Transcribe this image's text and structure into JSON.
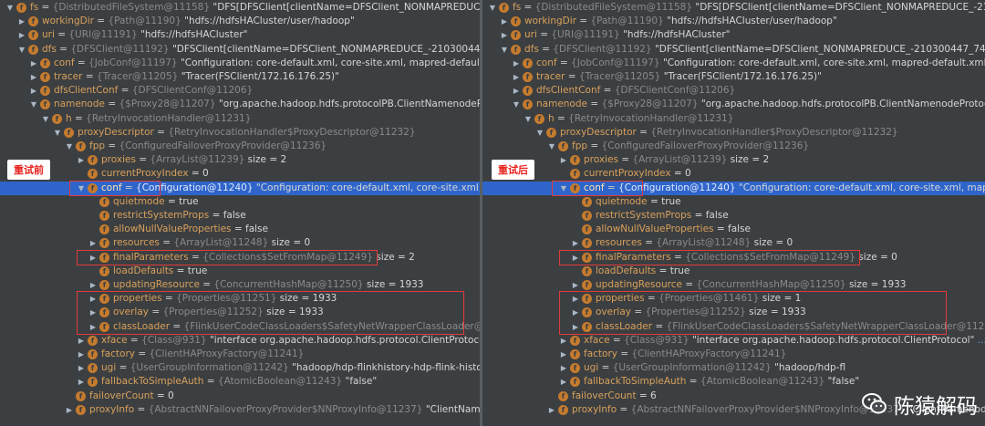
{
  "panels": {
    "left": {
      "badge": "重试前",
      "rows": [
        {
          "d": 0,
          "e": "d",
          "n": "fs",
          "r": "{DistributedFileSystem@11158}",
          "v": "\"DFS[DFSClient[clientName=DFSClient_NONMAPREDUCE_-210300447_74, ugi=hadoop/hdp-"
        },
        {
          "d": 1,
          "e": "r",
          "n": "workingDir",
          "r": "{Path@11190}",
          "v": "\"hdfs://hdfsHACluster/user/hadoop\""
        },
        {
          "d": 1,
          "e": "r",
          "n": "uri",
          "r": "{URI@11191}",
          "v": "\"hdfs://hdfsHACluster\""
        },
        {
          "d": 1,
          "e": "d",
          "n": "dfs",
          "r": "{DFSClient@11192}",
          "v": "\"DFSClient[clientName=DFSClient_NONMAPREDUCE_-210300447_74, ugi=hadoop/hdp-fl"
        },
        {
          "d": 2,
          "e": "r",
          "n": "conf",
          "r": "{JobConf@11197}",
          "v": "\"Configuration: core-default.xml, core-site.xml, mapred-default.xml, mapred-site.x"
        },
        {
          "d": 2,
          "e": "r",
          "n": "tracer",
          "r": "{Tracer@11205}",
          "v": "\"Tracer(FSClient/172.16.176.25)\""
        },
        {
          "d": 2,
          "e": "r",
          "n": "dfsClientConf",
          "r": "{DFSClientConf@11206}",
          "v": ""
        },
        {
          "d": 2,
          "e": "d",
          "n": "namenode",
          "r": "{$Proxy28@11207}",
          "v": "\"org.apache.hadoop.hdfs.protocolPB.ClientNamenodeProtocolTranslatorPB@"
        },
        {
          "d": 3,
          "e": "d",
          "n": "h",
          "r": "{RetryInvocationHandler@11231}",
          "v": ""
        },
        {
          "d": 4,
          "e": "d",
          "n": "proxyDescriptor",
          "r": "{RetryInvocationHandler$ProxyDescriptor@11232}",
          "v": ""
        },
        {
          "d": 5,
          "e": "d",
          "n": "fpp",
          "r": "{ConfiguredFailoverProxyProvider@11236}",
          "v": ""
        },
        {
          "d": 6,
          "e": "r",
          "n": "proxies",
          "r": "{ArrayList@11239}",
          "v": " size = 2"
        },
        {
          "d": 6,
          "e": "n",
          "n": "currentProxyIndex",
          "r": "",
          "v": "= 0"
        },
        {
          "d": 6,
          "e": "d",
          "n": "conf",
          "r": "{Configuration@11240}",
          "v": "\"Configuration: core-default.xml, core-site.xml, mapred-default.xml, mapr",
          "sel": true
        },
        {
          "d": 7,
          "e": "n",
          "n": "quietmode",
          "r": "",
          "v": "= true"
        },
        {
          "d": 7,
          "e": "n",
          "n": "restrictSystemProps",
          "r": "",
          "v": "= false"
        },
        {
          "d": 7,
          "e": "n",
          "n": "allowNullValueProperties",
          "r": "",
          "v": "= false"
        },
        {
          "d": 7,
          "e": "r",
          "n": "resources",
          "r": "{ArrayList@11248}",
          "v": " size = 0"
        },
        {
          "d": 7,
          "e": "r",
          "n": "finalParameters",
          "r": "{Collections$SetFromMap@11249}",
          "v": " size = 2"
        },
        {
          "d": 7,
          "e": "n",
          "n": "loadDefaults",
          "r": "",
          "v": "= true"
        },
        {
          "d": 7,
          "e": "r",
          "n": "updatingResource",
          "r": "{ConcurrentHashMap@11250}",
          "v": " size = 1933"
        },
        {
          "d": 7,
          "e": "r",
          "n": "properties",
          "r": "{Properties@11251}",
          "v": " size = 1933"
        },
        {
          "d": 7,
          "e": "r",
          "n": "overlay",
          "r": "{Properties@11252}",
          "v": " size = 1933"
        },
        {
          "d": 7,
          "e": "r",
          "n": "classLoader",
          "r": "{FlinkUserCodeClassLoaders$SafetyNetWrapperClassLoader@11253}",
          "v": ""
        },
        {
          "d": 6,
          "e": "r",
          "n": "xface",
          "r": "{Class@931}",
          "v": "\"interface org.apache.hadoop.hdfs.protocol.ClientProtocol\"",
          "link": "... Navigate"
        },
        {
          "d": 6,
          "e": "r",
          "n": "factory",
          "r": "{ClientHAProxyFactory@11241}",
          "v": ""
        },
        {
          "d": 6,
          "e": "r",
          "n": "ugi",
          "r": "{UserGroupInformation@11242}",
          "v": "\"hadoop/hdp-flinkhistory-hdp-flink-history-6754db4f9c-k68"
        },
        {
          "d": 6,
          "e": "r",
          "n": "fallbackToSimpleAuth",
          "r": "{AtomicBoolean@11243}",
          "v": "\"false\""
        },
        {
          "d": 5,
          "e": "n",
          "n": "failoverCount",
          "r": "",
          "v": "= 0"
        },
        {
          "d": 5,
          "e": "r",
          "n": "proxyInfo",
          "r": "{AbstractNNFailoverProxyProvider$NNProxyInfo@11237}",
          "v": "\"ClientNamenodeProtocol"
        }
      ]
    },
    "right": {
      "badge": "重试后",
      "rows": [
        {
          "d": 0,
          "e": "d",
          "n": "fs",
          "r": "{DistributedFileSystem@11158}",
          "v": "\"DFS[DFSClient[clientName=DFSClient_NONMAPREDUCE_-210300447_74, ugi=hadoop/hdp-"
        },
        {
          "d": 1,
          "e": "r",
          "n": "workingDir",
          "r": "{Path@11190}",
          "v": "\"hdfs://hdfsHACluster/user/hadoop\""
        },
        {
          "d": 1,
          "e": "r",
          "n": "uri",
          "r": "{URI@11191}",
          "v": "\"hdfs://hdfsHACluster\""
        },
        {
          "d": 1,
          "e": "d",
          "n": "dfs",
          "r": "{DFSClient@11192}",
          "v": "\"DFSClient[clientName=DFSClient_NONMAPREDUCE_-210300447_74, ugi=hadoop/hdp-fl"
        },
        {
          "d": 2,
          "e": "r",
          "n": "conf",
          "r": "{JobConf@11197}",
          "v": "\"Configuration: core-default.xml, core-site.xml, mapred-default.xml, mapred-site.x"
        },
        {
          "d": 2,
          "e": "r",
          "n": "tracer",
          "r": "{Tracer@11205}",
          "v": "\"Tracer(FSClient/172.16.176.25)\""
        },
        {
          "d": 2,
          "e": "r",
          "n": "dfsClientConf",
          "r": "{DFSClientConf@11206}",
          "v": ""
        },
        {
          "d": 2,
          "e": "d",
          "n": "namenode",
          "r": "{$Proxy28@11207}",
          "v": "\"org.apache.hadoop.hdfs.protocolPB.ClientNamenodeProtocolTranslatorPB@"
        },
        {
          "d": 3,
          "e": "d",
          "n": "h",
          "r": "{RetryInvocationHandler@11231}",
          "v": ""
        },
        {
          "d": 4,
          "e": "d",
          "n": "proxyDescriptor",
          "r": "{RetryInvocationHandler$ProxyDescriptor@11232}",
          "v": ""
        },
        {
          "d": 5,
          "e": "d",
          "n": "fpp",
          "r": "{ConfiguredFailoverProxyProvider@11236}",
          "v": ""
        },
        {
          "d": 6,
          "e": "r",
          "n": "proxies",
          "r": "{ArrayList@11239}",
          "v": " size = 2"
        },
        {
          "d": 6,
          "e": "n",
          "n": "currentProxyIndex",
          "r": "",
          "v": "= 0"
        },
        {
          "d": 6,
          "e": "d",
          "n": "conf",
          "r": "{Configuration@11240}",
          "v": "\"Configuration: core-default.xml, core-site.xml, mapred-default.xml, mapr",
          "sel": true
        },
        {
          "d": 7,
          "e": "n",
          "n": "quietmode",
          "r": "",
          "v": "= true"
        },
        {
          "d": 7,
          "e": "n",
          "n": "restrictSystemProps",
          "r": "",
          "v": "= false"
        },
        {
          "d": 7,
          "e": "n",
          "n": "allowNullValueProperties",
          "r": "",
          "v": "= false"
        },
        {
          "d": 7,
          "e": "r",
          "n": "resources",
          "r": "{ArrayList@11248}",
          "v": " size = 0"
        },
        {
          "d": 7,
          "e": "r",
          "n": "finalParameters",
          "r": "{Collections$SetFromMap@11249}",
          "v": " size = 0"
        },
        {
          "d": 7,
          "e": "n",
          "n": "loadDefaults",
          "r": "",
          "v": "= true"
        },
        {
          "d": 7,
          "e": "r",
          "n": "updatingResource",
          "r": "{ConcurrentHashMap@11250}",
          "v": " size = 1933"
        },
        {
          "d": 7,
          "e": "r",
          "n": "properties",
          "r": "{Properties@11461}",
          "v": " size = 1"
        },
        {
          "d": 7,
          "e": "r",
          "n": "overlay",
          "r": "{Properties@11252}",
          "v": " size = 1933"
        },
        {
          "d": 7,
          "e": "r",
          "n": "classLoader",
          "r": "{FlinkUserCodeClassLoaders$SafetyNetWrapperClassLoader@11253}",
          "v": ""
        },
        {
          "d": 6,
          "e": "r",
          "n": "xface",
          "r": "{Class@931}",
          "v": "\"interface org.apache.hadoop.hdfs.protocol.ClientProtocol\"",
          "link": "... Navigate"
        },
        {
          "d": 6,
          "e": "r",
          "n": "factory",
          "r": "{ClientHAProxyFactory@11241}",
          "v": ""
        },
        {
          "d": 6,
          "e": "r",
          "n": "ugi",
          "r": "{UserGroupInformation@11242}",
          "v": "\"hadoop/hdp-fl"
        },
        {
          "d": 6,
          "e": "r",
          "n": "fallbackToSimpleAuth",
          "r": "{AtomicBoolean@11243}",
          "v": "\"false\""
        },
        {
          "d": 5,
          "e": "n",
          "n": "failoverCount",
          "r": "",
          "v": "= 6"
        },
        {
          "d": 5,
          "e": "r",
          "n": "proxyInfo",
          "r": "{AbstractNNFailoverProxyProvider$NNProxyInfo@11237}",
          "v": "\"ClientNamenodeProtocol"
        }
      ]
    }
  },
  "field_icon": "f",
  "watermark": "陈猿解码",
  "colors": {
    "panel_bg": "#3c3f41",
    "selected_row": "#2f65ca",
    "field_icon": "#c57b2e",
    "highlight_box": "#e23a3a",
    "field_name": "#d8a05c"
  }
}
